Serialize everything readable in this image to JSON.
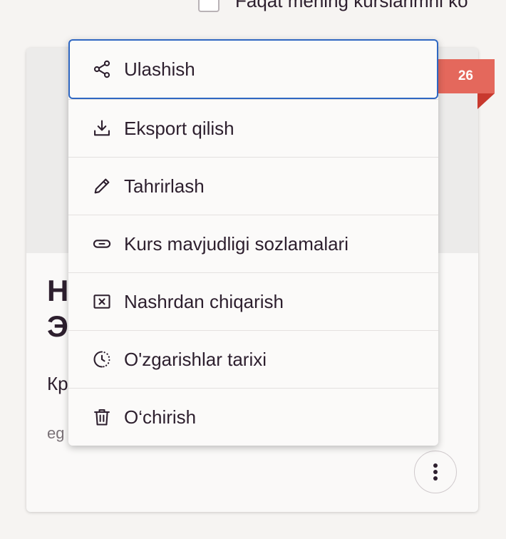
{
  "filter": {
    "label": "Faqat mening kurslarimni ko"
  },
  "card": {
    "ribbon_text": "26",
    "title": "Н\nЭ",
    "description": "Кр",
    "author": "eg"
  },
  "menu": {
    "items": [
      {
        "label": "Ulashish",
        "icon": "share-icon"
      },
      {
        "label": "Eksport qilish",
        "icon": "download-icon"
      },
      {
        "label": "Tahrirlash",
        "icon": "pencil-icon"
      },
      {
        "label": "Kurs mavjudligi sozlamalari",
        "icon": "link-icon"
      },
      {
        "label": "Nashrdan chiqarish",
        "icon": "unpublish-icon"
      },
      {
        "label": "O'zgarishlar tarixi",
        "icon": "history-icon"
      },
      {
        "label": "O‘chirish",
        "icon": "trash-icon"
      }
    ]
  },
  "colors": {
    "accent_focus": "#2f67c2",
    "ribbon": "#e4685c",
    "text": "#2d1f2e"
  }
}
